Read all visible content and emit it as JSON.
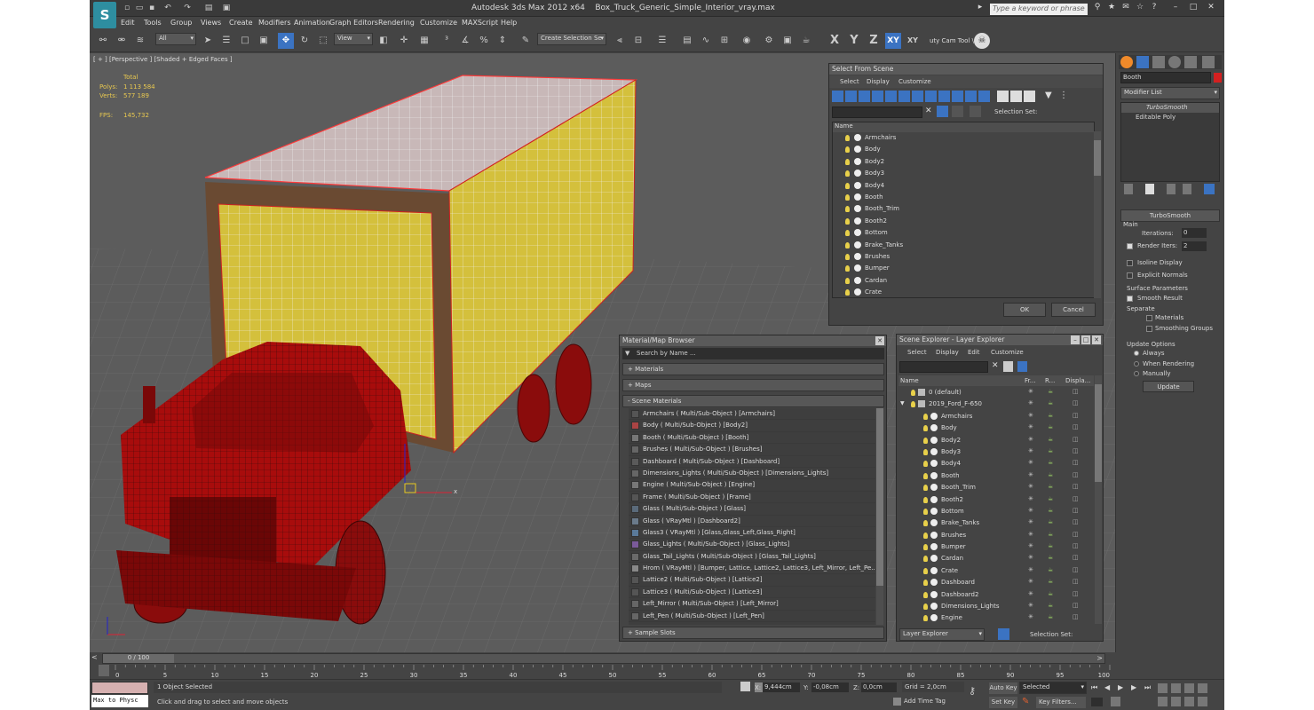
{
  "app": {
    "logo_letter": "S",
    "title": "Autodesk 3ds Max  2012 x64",
    "filename": "Box_Truck_Generic_Simple_Interior_vray.max",
    "search_placeholder": "Type a keyword or phrase"
  },
  "menu": [
    "Edit",
    "Tools",
    "Group",
    "Views",
    "Create",
    "Modifiers",
    "Animation",
    "Graph Editors",
    "Rendering",
    "Customize",
    "MAXScript",
    "Help"
  ],
  "toolbar": {
    "selection_filter": "All",
    "ref_coord": "View",
    "named_selection": "Create Selection Se",
    "axis_x": "X",
    "axis_y": "Y",
    "axis_z": "Z",
    "axis_xy": "XY",
    "axis_xy2": "XY",
    "cam_tool": "uty Cam Tool \\"
  },
  "viewport": {
    "label": "[ + ] [Perspective ] [Shaded + Edged Faces ]",
    "stats_header": "Total",
    "polys_label": "Polys:",
    "polys_value": "1 113 584",
    "verts_label": "Verts:",
    "verts_value": "577 189",
    "fps_label": "FPS:",
    "fps_value": "145,732",
    "axis_x": "x"
  },
  "select_from_scene": {
    "title": "Select From Scene",
    "menu": [
      "Select",
      "Display",
      "Customize"
    ],
    "selection_set_label": "Selection Set:",
    "column_name": "Name",
    "items": [
      "Armchairs",
      "Body",
      "Body2",
      "Body3",
      "Body4",
      "Booth",
      "Booth_Trim",
      "Booth2",
      "Bottom",
      "Brake_Tanks",
      "Brushes",
      "Bumper",
      "Cardan",
      "Crate"
    ],
    "ok": "OK",
    "cancel": "Cancel"
  },
  "material_browser": {
    "title": "Material/Map Browser",
    "search_placeholder": "Search by Name ...",
    "section_materials": "+ Materials",
    "section_maps": "+ Maps",
    "section_scene": "- Scene Materials",
    "section_sample": "+ Sample Slots",
    "items": [
      "Armchairs  ( Multi/Sub-Object ) [Armchairs]",
      "Body  ( Multi/Sub-Object ) [Body2]",
      "Booth  ( Multi/Sub-Object ) [Booth]",
      "Brushes  ( Multi/Sub-Object ) [Brushes]",
      "Dashboard  ( Multi/Sub-Object ) [Dashboard]",
      "Dimensions_Lights  ( Multi/Sub-Object ) [Dimensions_Lights]",
      "Engine  ( Multi/Sub-Object ) [Engine]",
      "Frame  ( Multi/Sub-Object ) [Frame]",
      "Glass  ( Multi/Sub-Object ) [Glass]",
      "Glass  ( VRayMtl ) [Dashboard2]",
      "Glass3  ( VRayMtl ) [Glass,Glass_Left,Glass_Right]",
      "Glass_Lights  ( Multi/Sub-Object ) [Glass_Lights]",
      "Glass_Tail_Lights  ( Multi/Sub-Object ) [Glass_Tail_Lights]",
      "Hrom  ( VRayMtl ) [Bumper, Lattice, Lattice2, Lattice3, Left_Mirror, Left_Pe...",
      "Lattice2  ( Multi/Sub-Object ) [Lattice2]",
      "Lattice3  ( Multi/Sub-Object ) [Lattice3]",
      "Left_Mirror  ( Multi/Sub-Object ) [Left_Mirror]",
      "Left_Pen  ( Multi/Sub-Object ) [Left_Pen]"
    ]
  },
  "scene_explorer": {
    "title": "Scene Explorer - Layer Explorer",
    "menu": [
      "Select",
      "Display",
      "Edit",
      "Customize"
    ],
    "col_name": "Name",
    "col_fr": "Fr...",
    "col_r": "R...",
    "col_display": "Displa...",
    "layers": [
      "0 (default)",
      "2019_Ford_F-650"
    ],
    "items": [
      "Armchairs",
      "Body",
      "Body2",
      "Body3",
      "Body4",
      "Booth",
      "Booth_Trim",
      "Booth2",
      "Bottom",
      "Brake_Tanks",
      "Brushes",
      "Bumper",
      "Cardan",
      "Crate",
      "Dashboard",
      "Dashboard2",
      "Dimensions_Lights",
      "Engine"
    ],
    "footer_dropdown": "Layer Explorer",
    "selection_set_label": "Selection Set:"
  },
  "command_panel": {
    "object_name": "Booth",
    "object_color": "#d42020",
    "modifier_list": "Modifier List",
    "stack": [
      "TurboSmooth",
      "Editable Poly"
    ],
    "rollout_title": "TurboSmooth",
    "main_label": "Main",
    "iterations_label": "Iterations:",
    "iterations_value": "0",
    "render_iters_label": "Render Iters:",
    "render_iters_value": "2",
    "isoline_label": "Isoline Display",
    "explicit_normals_label": "Explicit Normals",
    "surface_params_label": "Surface Parameters",
    "smooth_result_label": "Smooth Result",
    "separate_label": "Separate",
    "materials_label": "Materials",
    "smoothing_groups_label": "Smoothing Groups",
    "update_options_label": "Update Options",
    "always_label": "Always",
    "when_rendering_label": "When Rendering",
    "manually_label": "Manually",
    "update_button": "Update"
  },
  "timeline": {
    "frame_label": "0 / 100",
    "ticks": [
      "0",
      "5",
      "10",
      "15",
      "20",
      "25",
      "30",
      "35",
      "40",
      "45",
      "50",
      "55",
      "60",
      "65",
      "70",
      "75",
      "80",
      "85",
      "90",
      "95",
      "100"
    ]
  },
  "status": {
    "maxscript_label": "Max to Physc",
    "selected_text": "1 Object Selected",
    "prompt_text": "Click and drag to select and move objects",
    "x_label": "X:",
    "x_value": "9,444cm",
    "y_label": "Y:",
    "y_value": "-0,08cm",
    "z_label": "Z:",
    "z_value": "0,0cm",
    "grid": "Grid = 2,0cm",
    "add_time_tag": "Add Time Tag",
    "auto_key": "Auto Key",
    "set_key": "Set Key",
    "selected_dd": "Selected",
    "key_filters": "Key Filters..."
  }
}
